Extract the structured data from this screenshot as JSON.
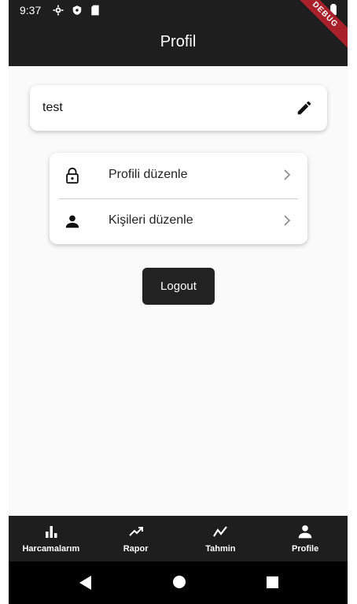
{
  "status_bar": {
    "time": "9:37",
    "debug_label": "DEBUG"
  },
  "app_bar": {
    "title": "Profil"
  },
  "user_card": {
    "username": "test"
  },
  "menu": {
    "items": [
      {
        "label": "Profili düzenle",
        "icon": "lock-icon"
      },
      {
        "label": "Kişileri düzenle",
        "icon": "person-icon"
      }
    ]
  },
  "logout": {
    "label": "Logout"
  },
  "bottom_nav": {
    "items": [
      {
        "label": "Harcamalarım",
        "icon": "bar-chart-icon"
      },
      {
        "label": "Rapor",
        "icon": "trending-up-icon"
      },
      {
        "label": "Tahmin",
        "icon": "line-chart-icon"
      },
      {
        "label": "Profile",
        "icon": "person-icon"
      }
    ]
  },
  "colors": {
    "appbar": "#1e1e1e",
    "background": "#fafafa",
    "button": "#222222",
    "debug": "#a8202a"
  }
}
